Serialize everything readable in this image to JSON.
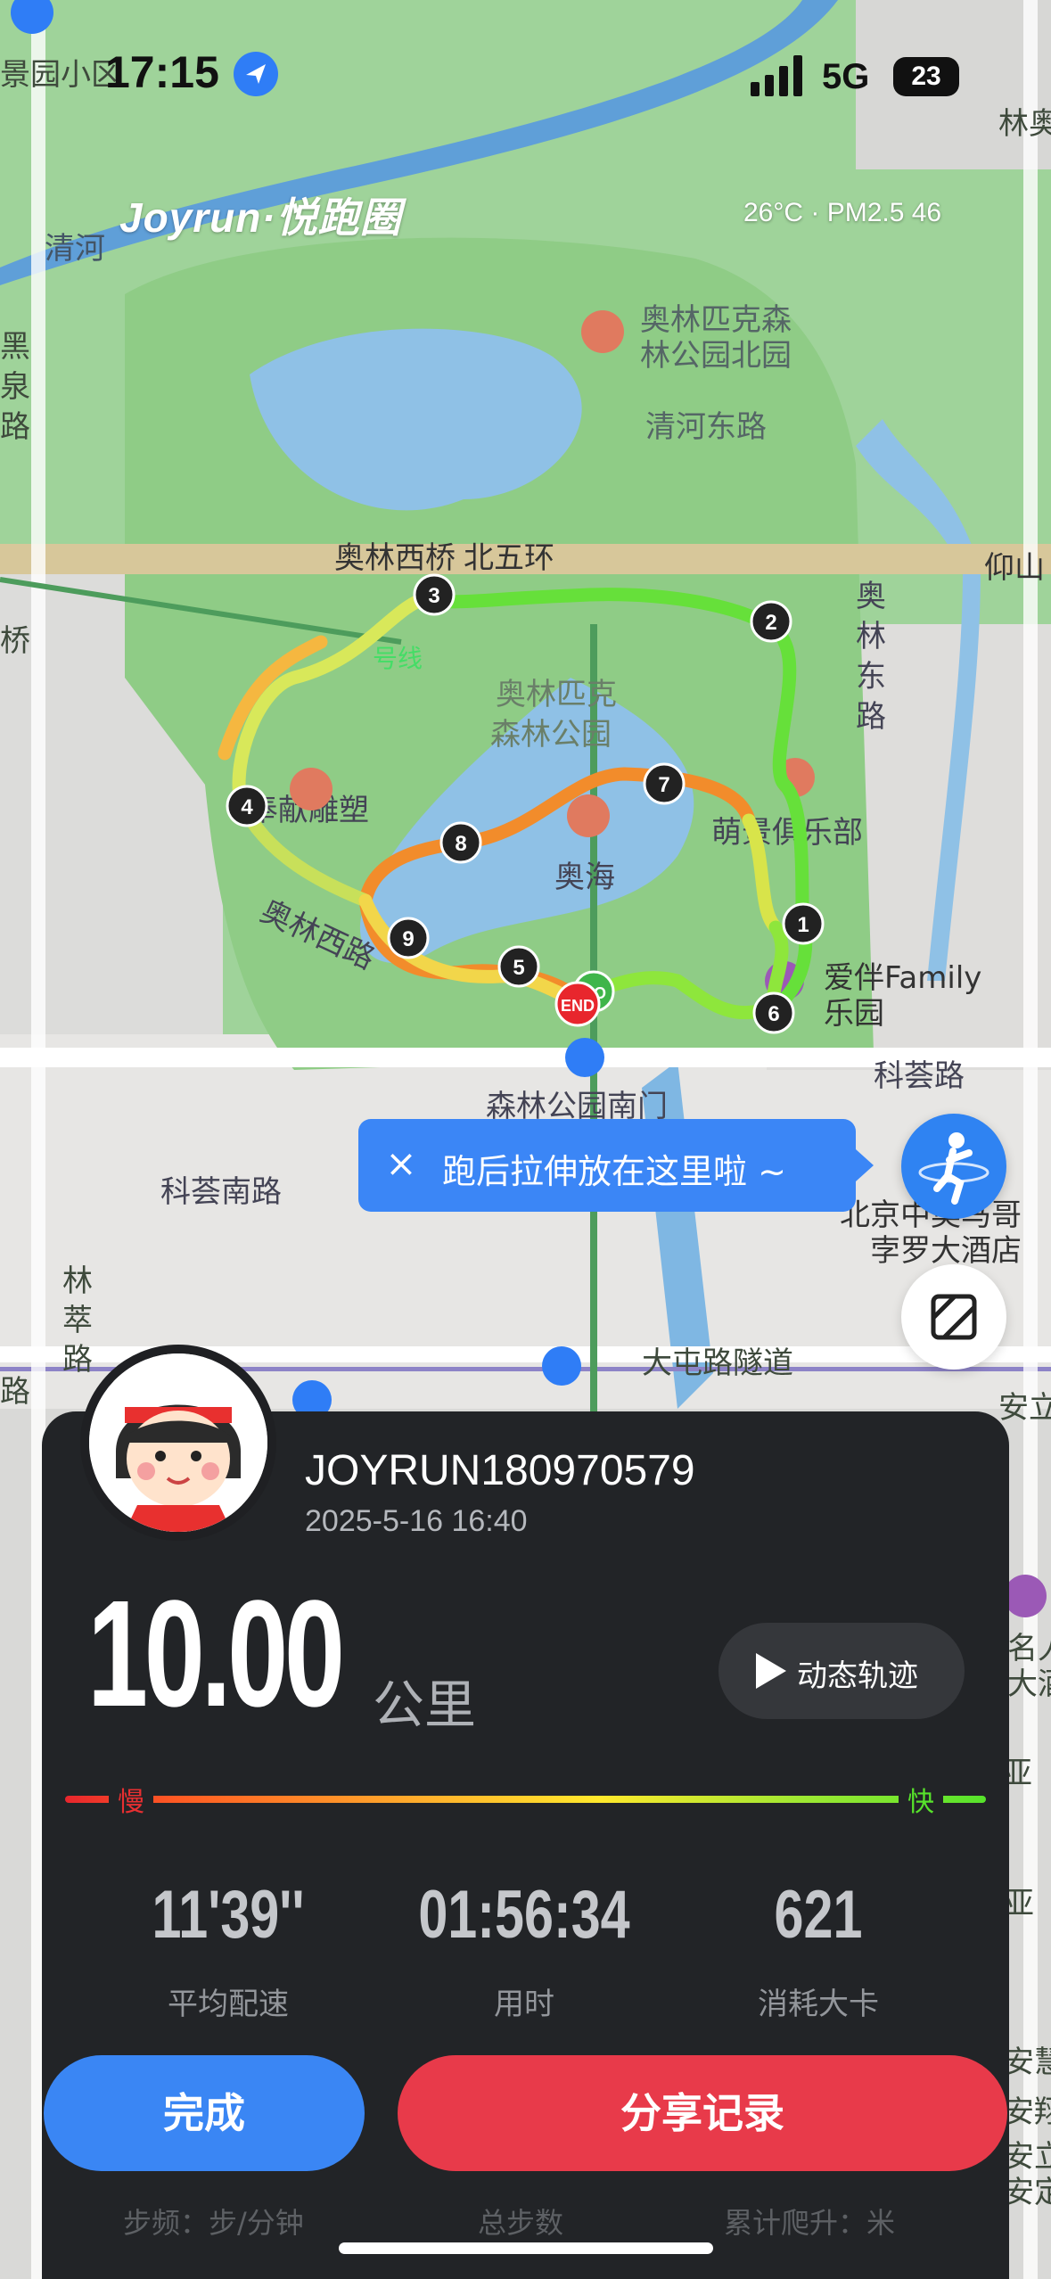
{
  "status_bar": {
    "time": "17:15",
    "network": "5G",
    "battery": "23"
  },
  "brand": "Joyrun·悦跑圈",
  "weather": "26°C · PM2.5 46",
  "map": {
    "labels": [
      "景园小区",
      "林奥",
      "清河",
      "奥林匹克森",
      "林公园北园",
      "清河东路",
      "黑",
      "泉",
      "路",
      "奥林西桥",
      "北五环",
      "仰山",
      "桥",
      "奥",
      "林",
      "东",
      "路",
      "奥林匹克",
      "森林公园",
      "萌景俱乐部",
      "奉献雕塑",
      "奥海",
      "奥林西路",
      "爱伴Family",
      "乐园",
      "科荟路",
      "森林公园南门",
      "科荟南路",
      "北京中奥马哥",
      "孛罗大酒店",
      "林",
      "萃",
      "路",
      "路",
      "大屯路隧道",
      "安立",
      "名人",
      "大酒",
      "亚",
      "安慧",
      "安翔",
      "安立路",
      "安定门",
      "亚"
    ],
    "lines": [
      "号线"
    ],
    "markers": [
      "1",
      "2",
      "3",
      "4",
      "5",
      "6",
      "7",
      "8",
      "9"
    ],
    "end_label": "END",
    "start_label": "GO"
  },
  "tip": {
    "close": "×",
    "text": "跑后拉伸放在这里啦 ~"
  },
  "icons": {
    "stretch": "stretch-person-icon",
    "layer": "map-layer-icon",
    "location": "location-arrow-icon"
  },
  "user": {
    "name": "JOYRUN180970579",
    "datetime": "2025-5-16 16:40"
  },
  "distance": {
    "value": "10.00",
    "unit": "公里"
  },
  "replay_label": "动态轨迹",
  "pace_scale": {
    "slow": "慢",
    "fast": "快"
  },
  "stats": [
    {
      "value": "11'39''",
      "label": "平均配速"
    },
    {
      "value": "01:56:34",
      "label": "用时"
    },
    {
      "value": "621",
      "label": "消耗大卡"
    }
  ],
  "buttons": {
    "done": "完成",
    "share": "分享记录"
  },
  "extra_stats": [
    "步频：步/分钟",
    "总步数",
    "累计爬升：米"
  ],
  "colors": {
    "route_slow": "#e8262d",
    "route_fast": "#56e32b",
    "primary": "#3a86f4",
    "share": "#e83a4a",
    "panel": "#222427"
  }
}
